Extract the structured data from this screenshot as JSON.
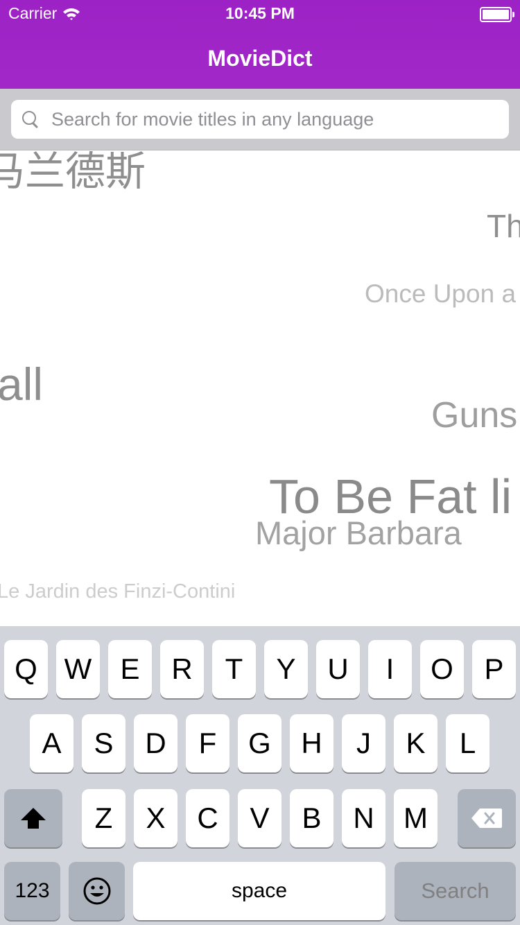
{
  "status_bar": {
    "carrier": "Carrier",
    "time": "10:45 PM"
  },
  "nav": {
    "title": "MovieDict"
  },
  "search": {
    "placeholder": "Search for movie titles in any language",
    "value": ""
  },
  "titles": [
    {
      "text": "马兰德斯",
      "color": "#8e8e8e"
    },
    {
      "text": "Th",
      "color": "#8e8e8e"
    },
    {
      "text": "Once Upon a",
      "color": "#bbbbbb"
    },
    {
      "text": "all",
      "color": "#8e8e8e"
    },
    {
      "text": "Guns",
      "color": "#9e9e9e"
    },
    {
      "text": "To Be Fat li",
      "color": "#8a8a8a"
    },
    {
      "text": "Major Barbara",
      "color": "#a2a2a2"
    },
    {
      "text": "Le Jardin des Finzi-Contini",
      "color": "#cccccc"
    }
  ],
  "keyboard": {
    "row1": [
      "Q",
      "W",
      "E",
      "R",
      "T",
      "Y",
      "U",
      "I",
      "O",
      "P"
    ],
    "row2": [
      "A",
      "S",
      "D",
      "F",
      "G",
      "H",
      "J",
      "K",
      "L"
    ],
    "row3": [
      "Z",
      "X",
      "C",
      "V",
      "B",
      "N",
      "M"
    ],
    "numbers_label": "123",
    "space_label": "space",
    "search_label": "Search",
    "shift_icon": "shift-icon",
    "delete_icon": "delete-icon",
    "emoji_icon": "emoji-icon"
  }
}
